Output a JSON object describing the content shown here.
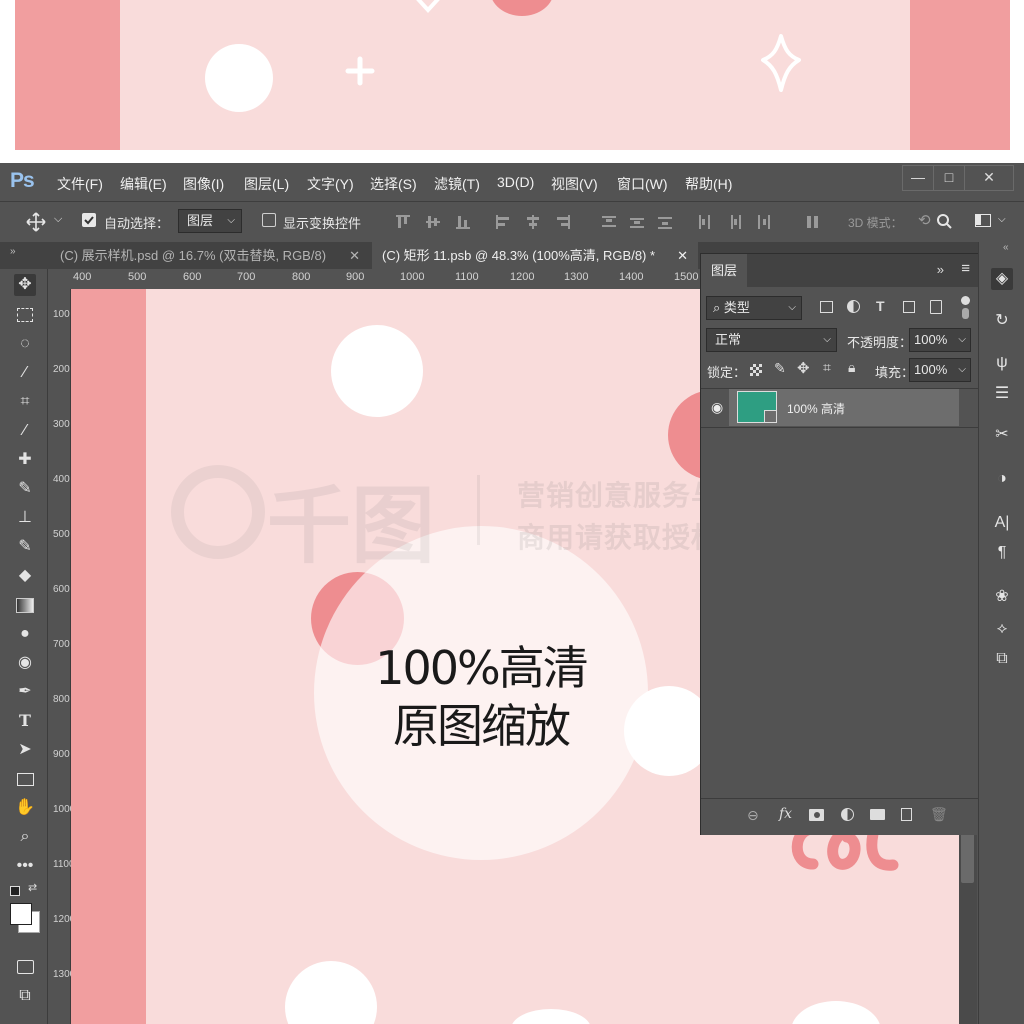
{
  "app": {
    "logo": "Ps"
  },
  "menubar": {
    "items": [
      {
        "label": "文件(F)"
      },
      {
        "label": "编辑(E)"
      },
      {
        "label": "图像(I)"
      },
      {
        "label": "图层(L)"
      },
      {
        "label": "文字(Y)"
      },
      {
        "label": "选择(S)"
      },
      {
        "label": "滤镜(T)"
      },
      {
        "label": "3D(D)"
      },
      {
        "label": "视图(V)"
      },
      {
        "label": "窗口(W)"
      },
      {
        "label": "帮助(H)"
      }
    ],
    "minimize": "—",
    "maximize": "□",
    "close": "✕"
  },
  "options_bar": {
    "auto_select_label": "自动选择：",
    "auto_select_checked": true,
    "auto_select_target": "图层",
    "show_transform_label": "显示变换控件",
    "show_transform_checked": false,
    "mode_3d_label": "3D 模式："
  },
  "tabs": [
    {
      "label": "(C) 展示样机.psd @ 16.7% (双击替换, RGB/8)",
      "close": "✕",
      "active": false
    },
    {
      "label": "(C) 矩形 11.psb @ 48.3% (100%高清, RGB/8) *",
      "close": "✕",
      "active": true
    }
  ],
  "ruler_top": [
    "400",
    "500",
    "600",
    "700",
    "800",
    "900",
    "1000",
    "1100",
    "1200",
    "1300",
    "1400",
    "1500"
  ],
  "ruler_left": [
    "100",
    "200",
    "300",
    "400",
    "500",
    "600",
    "700",
    "800",
    "900",
    "1000",
    "1100",
    "1200",
    "1300"
  ],
  "canvas": {
    "line1": "100%高清",
    "line2": "原图缩放",
    "watermark_logo": "千图",
    "watermark_line1": "营销创意服务与协作平台",
    "watermark_line2": "商用请获取授权",
    "colors": {
      "background": "#f9dcdb",
      "stripe": "#f19e9f",
      "accent_circle": "#ee8d90",
      "white": "#ffffff"
    }
  },
  "layers_panel": {
    "title": "图层",
    "filter_kind": "类型",
    "blend_mode": "正常",
    "opacity_label": "不透明度：",
    "opacity_value": "100%",
    "lock_label": "锁定：",
    "fill_label": "填充：",
    "fill_value": "100%",
    "layers": [
      {
        "name": "100% 高清",
        "visible": true,
        "thumb_color": "#2e9e82"
      }
    ],
    "bottom_fx": "fx"
  }
}
